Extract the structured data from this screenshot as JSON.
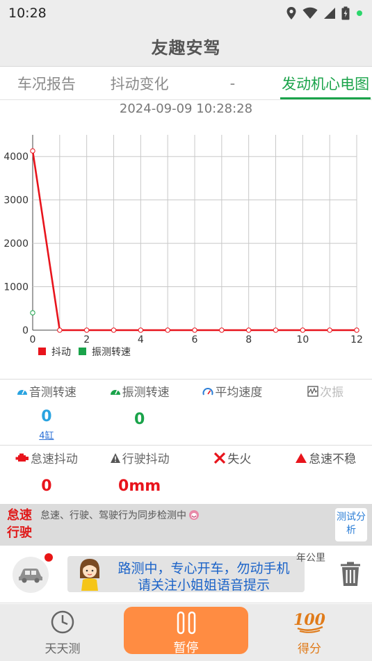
{
  "status": {
    "time": "10:28"
  },
  "app": {
    "title": "友趣安驾"
  },
  "tabs": [
    {
      "label": "车况报告",
      "active": false
    },
    {
      "label": "抖动变化",
      "active": false
    },
    {
      "label": "-",
      "active": false
    },
    {
      "label": "发动机心电图",
      "active": true
    }
  ],
  "timestamp": "2024-09-09 10:28:28",
  "chart_data": {
    "type": "line",
    "x": [
      0,
      1,
      2,
      3,
      4,
      5,
      6,
      7,
      8,
      9,
      10,
      11,
      12
    ],
    "xlim": [
      0,
      12
    ],
    "ylim": [
      0,
      4500
    ],
    "xticks": [
      "0",
      "2",
      "4",
      "6",
      "8",
      "10",
      "12"
    ],
    "yticks": [
      "0",
      "1000",
      "2000",
      "3000",
      "4000"
    ],
    "grid": true,
    "legend_position": "bottom-left",
    "series": [
      {
        "name": "抖动",
        "color": "#e8141c",
        "x": [
          0,
          1,
          2,
          3,
          4,
          5,
          6,
          7,
          8,
          9,
          10,
          11,
          12
        ],
        "values": [
          4130,
          0,
          0,
          0,
          0,
          0,
          0,
          0,
          0,
          0,
          0,
          0,
          0
        ]
      },
      {
        "name": "振测转速",
        "color": "#1aa34a",
        "x": [
          0
        ],
        "values": [
          400
        ]
      }
    ]
  },
  "metrics_row1": [
    {
      "label": "音测转速",
      "value": "0",
      "sub": "4缸",
      "color": "#29a3e0",
      "icon": "gauge-icon"
    },
    {
      "label": "振测转速",
      "value": "0",
      "sub": "",
      "color": "#1aa34a",
      "icon": "gauge-icon"
    },
    {
      "label": "平均速度",
      "value": "",
      "sub": "",
      "color": "#2a7dd6",
      "icon": "speedometer-icon"
    },
    {
      "label": "次振",
      "value": "",
      "sub": "",
      "color": "#bbbbbb",
      "icon": "wave-icon"
    }
  ],
  "metrics_row2": [
    {
      "label": "怠速抖动",
      "value": "0",
      "icon": "engine-icon"
    },
    {
      "label": "行驶抖动",
      "value": "0mm",
      "icon": "warning-icon"
    },
    {
      "label": "失火",
      "value": "",
      "icon": "cross-icon"
    },
    {
      "label": "怠速不稳",
      "value": "",
      "icon": "triangle-icon"
    }
  ],
  "banner": {
    "tag": "怠速行驶",
    "message": "怠速、行驶、驾驶行为同步检测中",
    "button": "测试分析"
  },
  "notice": {
    "line1": "路测中，专心开车，勿动手机",
    "line2": "请关注小姐姐语音提示",
    "unit": "年公里"
  },
  "nav": {
    "left": "天天测",
    "center": "暂停",
    "right": "得分",
    "right_badge": "100"
  },
  "colors": {
    "accent": "#1aa34a",
    "red": "#e8141c",
    "orange": "#ff8c42",
    "blue": "#1b63c8"
  }
}
